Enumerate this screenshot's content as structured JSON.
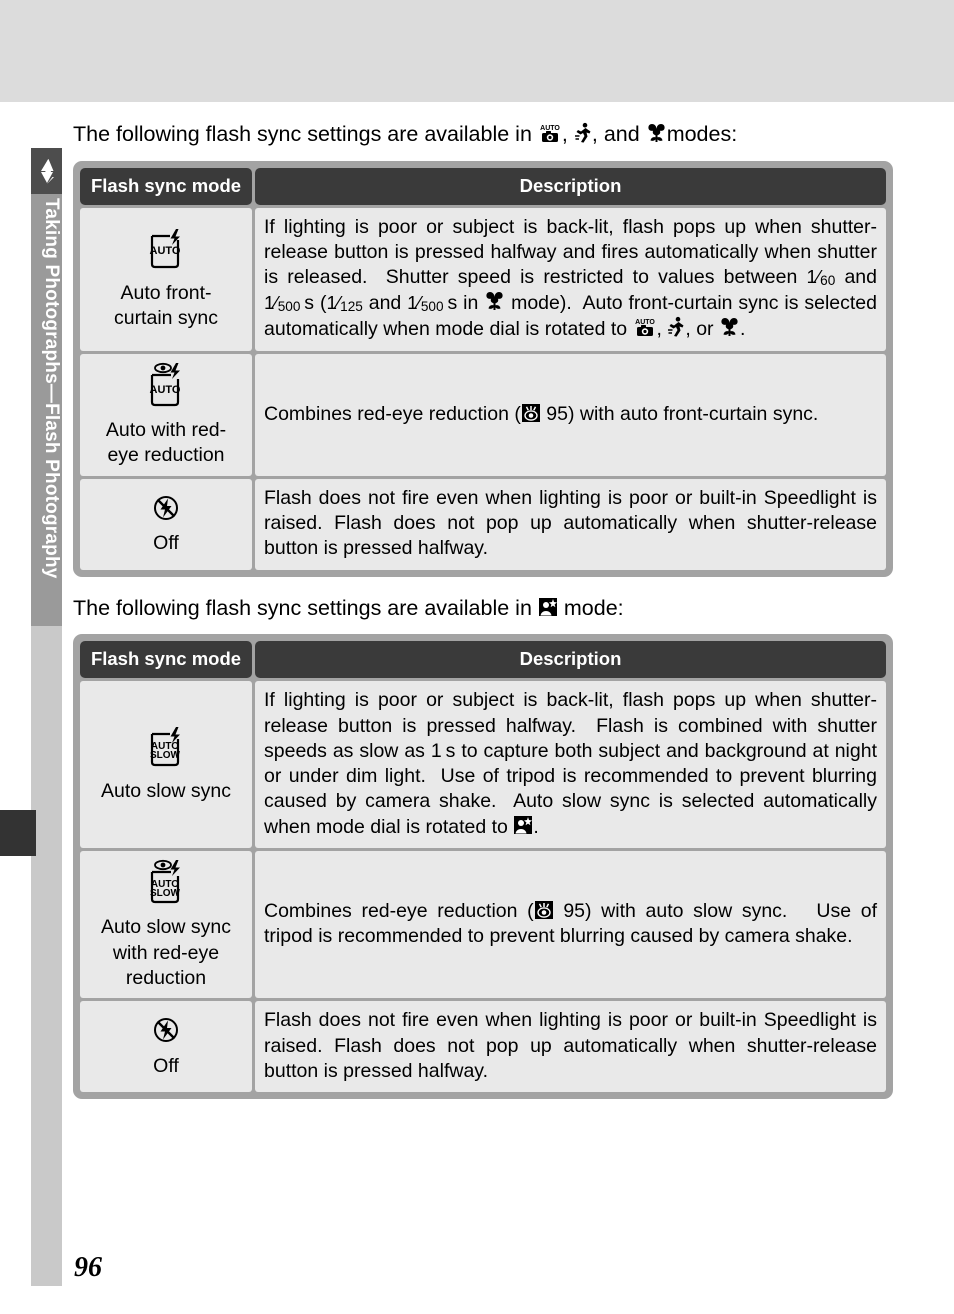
{
  "sidebar": {
    "flash_icon": "flash-bolt-icon",
    "tab_label": "Taking Photographs—Flash Photography"
  },
  "page": {
    "number": "96"
  },
  "section1": {
    "intro_before": "The following flash sync settings are available in",
    "intro_icon1": "auto-camera-icon",
    "intro_sep1": ",",
    "intro_icon2": "sports-runner-icon",
    "intro_sep2": ", and",
    "intro_icon3": "macro-flower-icon",
    "intro_after": "modes:",
    "headers": {
      "mode": "Flash sync mode",
      "description": "Description"
    },
    "rows": [
      {
        "icon": "auto-front-curtain-flash-icon",
        "icon_text_top": "",
        "icon_text_main": "AUTO",
        "has_eye": false,
        "has_slow": false,
        "label": "Auto front-\ncurtain sync",
        "label_lines": [
          "Auto front-",
          "curtain sync"
        ],
        "description_parts": [
          {
            "t": "text",
            "v": "If lighting is poor or subject is back-lit, flash pops up when shutter-release button is pressed halfway and fires automatically when shutter is released.  Shutter speed is restricted to values between "
          },
          {
            "t": "frac",
            "num": "1",
            "den": "60"
          },
          {
            "t": "text",
            "v": " and "
          },
          {
            "t": "frac",
            "num": "1",
            "den": "500"
          },
          {
            "t": "text",
            "v": " s ("
          },
          {
            "t": "frac",
            "num": "1",
            "den": "125"
          },
          {
            "t": "text",
            "v": " and "
          },
          {
            "t": "frac",
            "num": "1",
            "den": "500"
          },
          {
            "t": "text",
            "v": " s in "
          },
          {
            "t": "icon",
            "v": "macro-flower-icon"
          },
          {
            "t": "text",
            "v": " mode).  Auto front-curtain sync is selected automatically when mode dial is rotated to "
          },
          {
            "t": "icon",
            "v": "auto-camera-icon"
          },
          {
            "t": "text",
            "v": ", "
          },
          {
            "t": "icon",
            "v": "sports-runner-icon"
          },
          {
            "t": "text",
            "v": ", or "
          },
          {
            "t": "icon",
            "v": "macro-flower-icon"
          },
          {
            "t": "text",
            "v": "."
          }
        ]
      },
      {
        "icon": "auto-red-eye-flash-icon",
        "icon_text_main": "AUTO",
        "has_eye": true,
        "has_slow": false,
        "label_lines": [
          "Auto with red-",
          "eye reduction"
        ],
        "description_parts": [
          {
            "t": "text",
            "v": "Combines red-eye reduction ("
          },
          {
            "t": "icon",
            "v": "page-reference-icon"
          },
          {
            "t": "text",
            "v": " 95) with auto front-curtain sync."
          }
        ]
      },
      {
        "icon": "flash-off-icon",
        "label_lines": [
          "Off"
        ],
        "description_parts": [
          {
            "t": "text",
            "v": "Flash does not fire even when lighting is poor or built-in Speedlight is raised.  Flash does not pop up automatically when shutter-release button is pressed halfway."
          }
        ]
      }
    ]
  },
  "section2": {
    "intro_before": "The following flash sync settings are available in",
    "intro_icon1": "night-portrait-icon",
    "intro_after": "mode:",
    "headers": {
      "mode": "Flash sync mode",
      "description": "Description"
    },
    "rows": [
      {
        "icon": "auto-slow-sync-flash-icon",
        "icon_text_main": "AUTO",
        "icon_text_sub": "SLOW",
        "has_eye": false,
        "has_slow": true,
        "label_lines": [
          "Auto slow sync"
        ],
        "description_parts": [
          {
            "t": "text",
            "v": "If lighting is poor or subject is back-lit, flash pops up when shutter-release button is pressed halfway.  Flash is combined with shutter speeds as slow as 1 s to capture both subject and background at night or under dim light.  Use of tripod is recommended to prevent blurring caused by camera shake.  Auto slow sync is selected automatically when mode dial is rotated to "
          },
          {
            "t": "icon",
            "v": "night-portrait-icon"
          },
          {
            "t": "text",
            "v": "."
          }
        ]
      },
      {
        "icon": "auto-slow-sync-red-eye-flash-icon",
        "icon_text_main": "AUTO",
        "icon_text_sub": "SLOW",
        "has_eye": true,
        "has_slow": true,
        "label_lines": [
          "Auto slow sync",
          "with red-eye",
          "reduction"
        ],
        "description_parts": [
          {
            "t": "text",
            "v": "Combines red-eye reduction ("
          },
          {
            "t": "icon",
            "v": "page-reference-icon"
          },
          {
            "t": "text",
            "v": " 95) with auto slow sync.   Use of tripod is recommended to prevent blurring caused by camera shake."
          }
        ]
      },
      {
        "icon": "flash-off-icon",
        "label_lines": [
          "Off"
        ],
        "description_parts": [
          {
            "t": "text",
            "v": "Flash does not fire even when lighting is poor or built-in Speedlight is raised.  Flash does not pop up automatically when shutter-release button is pressed halfway."
          }
        ]
      }
    ]
  },
  "colors": {
    "top_band": "#dcdcdc",
    "tab_dark": "#4d4d4d",
    "tab_gray": "#9a9a9a",
    "table_frame": "#a3a3a3",
    "table_header": "#3a3a3a",
    "table_cell": "#e9e9e9"
  }
}
